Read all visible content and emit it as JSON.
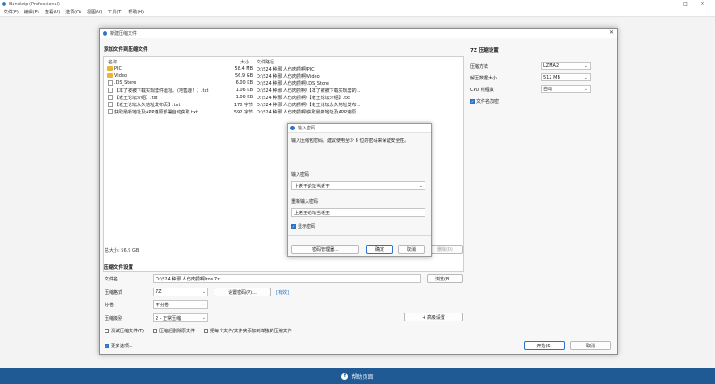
{
  "app": {
    "title": "Bandizip (Professional)"
  },
  "menu": [
    "文件(F)",
    "编辑(E)",
    "查看(V)",
    "选项(O)",
    "视图(V)",
    "工具(T)",
    "帮助(H)"
  ],
  "dialog": {
    "title": "新建压缩文件",
    "add_files_title": "添加文件到压缩文件",
    "columns": {
      "name": "名称",
      "size": "大小",
      "path": "文件路径"
    },
    "files": [
      {
        "icon": "folder",
        "name": "PIC",
        "size": "58.4 MB",
        "path": "D:\\S24 种邪 人伤肉攒啊\\PIC"
      },
      {
        "icon": "folder",
        "name": "Video",
        "size": "56.9 GB",
        "path": "D:\\S24 种邪 人伤肉攒啊\\Video"
      },
      {
        "icon": "file",
        "name": ".DS_Store",
        "size": "6.00 KB",
        "path": "D:\\S24 种邪 人伤肉攒啊\\.DS_Store"
      },
      {
        "icon": "file",
        "name": "【本了被被下载实现套件运址。(地售趣！】.txt",
        "size": "1.06 KB",
        "path": "D:\\S24 种邪 人伤肉攒啊\\【本了被被下载实现套的..."
      },
      {
        "icon": "file",
        "name": "【老王论坛介绍】.txt",
        "size": "1.06 KB",
        "path": "D:\\S24 种邪 人伤肉攒啊\\【老王论坛介绍】.txt"
      },
      {
        "icon": "file",
        "name": "【老王论坛永久地址发布页】.txt",
        "size": "170 字节",
        "path": "D:\\S24 种邪 人伤肉攒啊\\【老王论坛永久地址发布..."
      },
      {
        "icon": "file",
        "name": "获取最新地址及APP遵原部署自动获取.txt",
        "size": "592 字节",
        "path": "D:\\S24 种邪 人伤肉攒啊\\获取最新地址及APP遵原..."
      }
    ],
    "total_size": "总大小: 56.9 GB",
    "delete_button": "删除(D)",
    "settings_title": "压缩文件设置",
    "filename_label": "文件名",
    "filename_value": "D:\\S24 种邪 人伤肉攒啊\\ros.7z",
    "browse_button": "浏览(B)...",
    "format_label": "压缩格式",
    "format_value": "7Z",
    "set_password_button": "设置密码(P)...",
    "encrypted_tag": "[有效]",
    "split_label": "分卷",
    "split_value": "不分卷",
    "level_label": "压缩级别",
    "level_value": "2 - 正常压缩",
    "advanced_button": "+ 高级设置",
    "options": [
      {
        "label": "测试压缩文件(T)",
        "checked": false
      },
      {
        "label": "压缩后删除原文件",
        "checked": false
      },
      {
        "label": "把每个文件/文件夹添加到单独的压缩文件",
        "checked": false
      }
    ],
    "more_options": {
      "label": "更多选项...",
      "checked": true
    },
    "start_button": "开始(S)",
    "cancel_button": "取消"
  },
  "right_panel": {
    "title": "7Z 压缩设置",
    "rows": [
      {
        "label": "压缩方法",
        "value": "LZMA2"
      },
      {
        "label": "解压数据大小",
        "value": "512 MB"
      },
      {
        "label": "CPU 线程数",
        "value": "自动"
      }
    ],
    "encrypt_names": {
      "label": "文件名加密",
      "checked": true
    }
  },
  "password_dialog": {
    "title": "输入密码",
    "hint": "输入压缩包密码。建议使用至少 8 位的密码来保证安全性。",
    "enter_label": "输入密码",
    "enter_value": "上老王论坛当老王",
    "reenter_label": "重新输入密码",
    "reenter_value": "上老王论坛当老王",
    "show_password": {
      "label": "显示密码",
      "checked": true
    },
    "manager_button": "密码管理器...",
    "ok_button": "确定",
    "cancel_button": "取消"
  },
  "bottom_bar": {
    "label": "帮助页面"
  }
}
